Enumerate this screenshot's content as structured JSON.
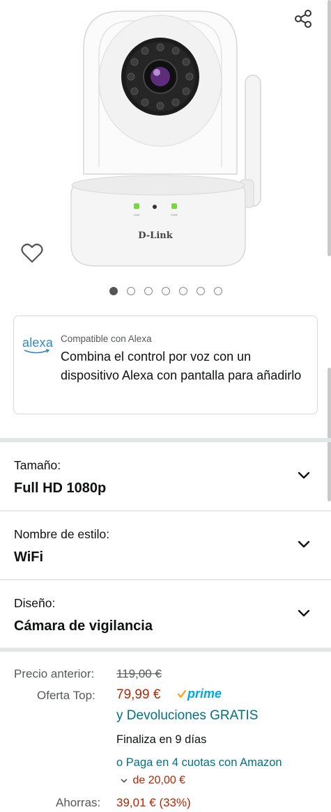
{
  "gallery": {
    "image_alt": "D-Link camera",
    "brand_on_product": "D-Link",
    "led_labels": [
      "LINK",
      "PWR"
    ],
    "image_count": 7,
    "active_index": 0
  },
  "alexa": {
    "logo": "alexa",
    "compat_label": "Compatible con Alexa",
    "message": "Combina el control por voz con un dispositivo Alexa con pantalla para añadirlo"
  },
  "options": [
    {
      "label": "Tamaño:",
      "value": "Full HD 1080p"
    },
    {
      "label": "Nombre de estilo:",
      "value": "WiFi"
    },
    {
      "label": "Diseño:",
      "value": "Cámara de vigilancia"
    }
  ],
  "pricing": {
    "previous_label": "Precio anterior:",
    "previous_price": "119,00 €",
    "offer_label": "Oferta Top:",
    "offer_price": "79,99 €",
    "prime": "prime",
    "returns": "y Devoluciones GRATIS",
    "ends": "Finaliza en 9 días",
    "installments_prefix": "o",
    "installments_link": "Paga en 4 cuotas con Amazon",
    "installments_amount": "de 20,00 €",
    "savings_label": "Ahorras:",
    "savings_value": "39,01 € (33%)"
  },
  "colors": {
    "price_red": "#b12704",
    "link_teal": "#007185",
    "prime_blue": "#00a8e1",
    "prime_check": "#ffa41c",
    "alexa_blue": "#2e87c6"
  }
}
